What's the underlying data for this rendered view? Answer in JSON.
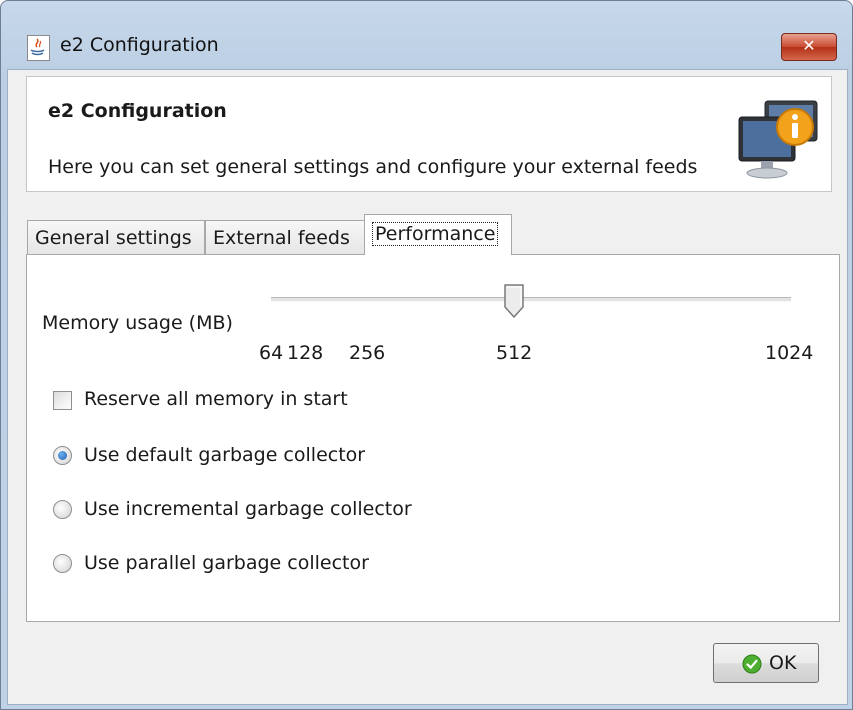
{
  "window": {
    "title": "e2 Configuration",
    "close_label": "✕"
  },
  "header": {
    "title": "e2 Configuration",
    "description": "Here you can set general settings and configure your external feeds",
    "icon": "monitor-info-icon"
  },
  "tabs": [
    {
      "label": "General settings",
      "active": false
    },
    {
      "label": "External feeds",
      "active": false
    },
    {
      "label": "Performance",
      "active": true
    }
  ],
  "performance": {
    "memory_label": "Memory usage (MB)",
    "slider": {
      "min": 64,
      "max": 1024,
      "value": 512
    },
    "ticks": [
      "64",
      "128",
      "256",
      "512",
      "1024"
    ],
    "reserve_memory": {
      "label": "Reserve all memory in start",
      "checked": false
    },
    "gc_options": [
      {
        "label": "Use default garbage collector",
        "selected": true
      },
      {
        "label": "Use incremental garbage collector",
        "selected": false
      },
      {
        "label": "Use parallel garbage collector",
        "selected": false
      }
    ]
  },
  "footer": {
    "ok_label": "OK"
  },
  "colors": {
    "window_frame": "#bfd2e6",
    "accent": "#1a5fb4",
    "close_red": "#c94a32",
    "ok_green": "#4caf2f"
  }
}
